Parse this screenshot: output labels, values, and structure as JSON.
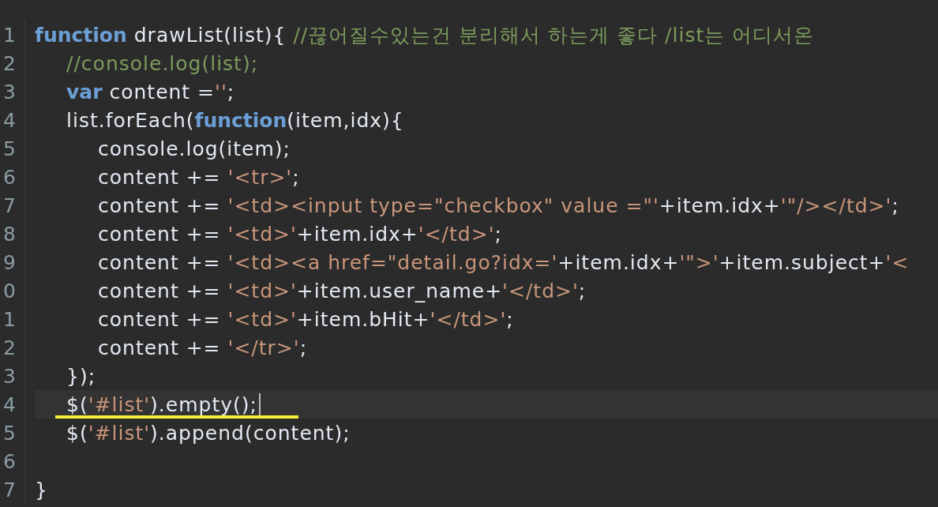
{
  "editor": {
    "lines": [
      {
        "number": "1",
        "current": false,
        "underlined": false,
        "tokens": [
          {
            "kind": "keyword",
            "text": "function"
          },
          {
            "kind": "plain",
            "text": " drawList(list){ "
          },
          {
            "kind": "comment",
            "text": "//끊어질수있는건 분리해서 하는게 좋다 /list는 어디서온"
          }
        ]
      },
      {
        "number": "2",
        "current": false,
        "underlined": false,
        "tokens": [
          {
            "kind": "comment",
            "text": "\t//console.log(list);"
          }
        ]
      },
      {
        "number": "3",
        "current": false,
        "underlined": false,
        "tokens": [
          {
            "kind": "keyword",
            "text": "\tvar"
          },
          {
            "kind": "plain",
            "text": " content ="
          },
          {
            "kind": "string",
            "text": "''"
          },
          {
            "kind": "plain",
            "text": ";"
          }
        ]
      },
      {
        "number": "4",
        "current": false,
        "underlined": false,
        "tokens": [
          {
            "kind": "plain",
            "text": "\tlist.forEach("
          },
          {
            "kind": "keyword",
            "text": "function"
          },
          {
            "kind": "plain",
            "text": "(item,idx){"
          }
        ]
      },
      {
        "number": "5",
        "current": false,
        "underlined": false,
        "tokens": [
          {
            "kind": "plain",
            "text": "\t\tconsole.log(item);"
          }
        ]
      },
      {
        "number": "6",
        "current": false,
        "underlined": false,
        "tokens": [
          {
            "kind": "plain",
            "text": "\t\tcontent += "
          },
          {
            "kind": "string",
            "text": "'<tr>'"
          },
          {
            "kind": "plain",
            "text": ";"
          }
        ]
      },
      {
        "number": "7",
        "current": false,
        "underlined": false,
        "tokens": [
          {
            "kind": "plain",
            "text": "\t\tcontent += "
          },
          {
            "kind": "string",
            "text": "'<td><input type=\"checkbox\" value =\"'"
          },
          {
            "kind": "plain",
            "text": "+item.idx+"
          },
          {
            "kind": "string",
            "text": "'\"/></td>'"
          },
          {
            "kind": "plain",
            "text": ";"
          }
        ]
      },
      {
        "number": "8",
        "current": false,
        "underlined": false,
        "tokens": [
          {
            "kind": "plain",
            "text": "\t\tcontent += "
          },
          {
            "kind": "string",
            "text": "'<td>'"
          },
          {
            "kind": "plain",
            "text": "+item.idx+"
          },
          {
            "kind": "string",
            "text": "'</td>'"
          },
          {
            "kind": "plain",
            "text": ";"
          }
        ]
      },
      {
        "number": "9",
        "current": false,
        "underlined": false,
        "tokens": [
          {
            "kind": "plain",
            "text": "\t\tcontent += "
          },
          {
            "kind": "string",
            "text": "'<td><a href=\"detail.go?idx='"
          },
          {
            "kind": "plain",
            "text": "+item.idx+"
          },
          {
            "kind": "string",
            "text": "'\">'"
          },
          {
            "kind": "plain",
            "text": "+item.subject+"
          },
          {
            "kind": "string",
            "text": "'<"
          }
        ]
      },
      {
        "number": "0",
        "current": false,
        "underlined": false,
        "tokens": [
          {
            "kind": "plain",
            "text": "\t\tcontent += "
          },
          {
            "kind": "string",
            "text": "'<td>'"
          },
          {
            "kind": "plain",
            "text": "+item.user_name+"
          },
          {
            "kind": "string",
            "text": "'</td>'"
          },
          {
            "kind": "plain",
            "text": ";"
          }
        ]
      },
      {
        "number": "1",
        "current": false,
        "underlined": false,
        "tokens": [
          {
            "kind": "plain",
            "text": "\t\tcontent += "
          },
          {
            "kind": "string",
            "text": "'<td>'"
          },
          {
            "kind": "plain",
            "text": "+item.bHit+"
          },
          {
            "kind": "string",
            "text": "'</td>'"
          },
          {
            "kind": "plain",
            "text": ";"
          }
        ]
      },
      {
        "number": "2",
        "current": false,
        "underlined": false,
        "tokens": [
          {
            "kind": "plain",
            "text": "\t\tcontent += "
          },
          {
            "kind": "string",
            "text": "'</tr>'"
          },
          {
            "kind": "plain",
            "text": ";"
          }
        ]
      },
      {
        "number": "3",
        "current": false,
        "underlined": false,
        "tokens": [
          {
            "kind": "plain",
            "text": "\t});"
          }
        ]
      },
      {
        "number": "4",
        "current": true,
        "underlined": true,
        "tokens": [
          {
            "kind": "plain",
            "text": "\t$("
          },
          {
            "kind": "string",
            "text": "'#list'"
          },
          {
            "kind": "plain",
            "text": ").empty();"
          }
        ]
      },
      {
        "number": "5",
        "current": false,
        "underlined": false,
        "tokens": [
          {
            "kind": "plain",
            "text": "\t$("
          },
          {
            "kind": "string",
            "text": "'#list'"
          },
          {
            "kind": "plain",
            "text": ").append(content);"
          }
        ]
      },
      {
        "number": "6"
      },
      {
        "number": "7",
        "current": false,
        "underlined": false,
        "tokens": [
          {
            "kind": "plain",
            "text": "}"
          }
        ]
      }
    ]
  }
}
